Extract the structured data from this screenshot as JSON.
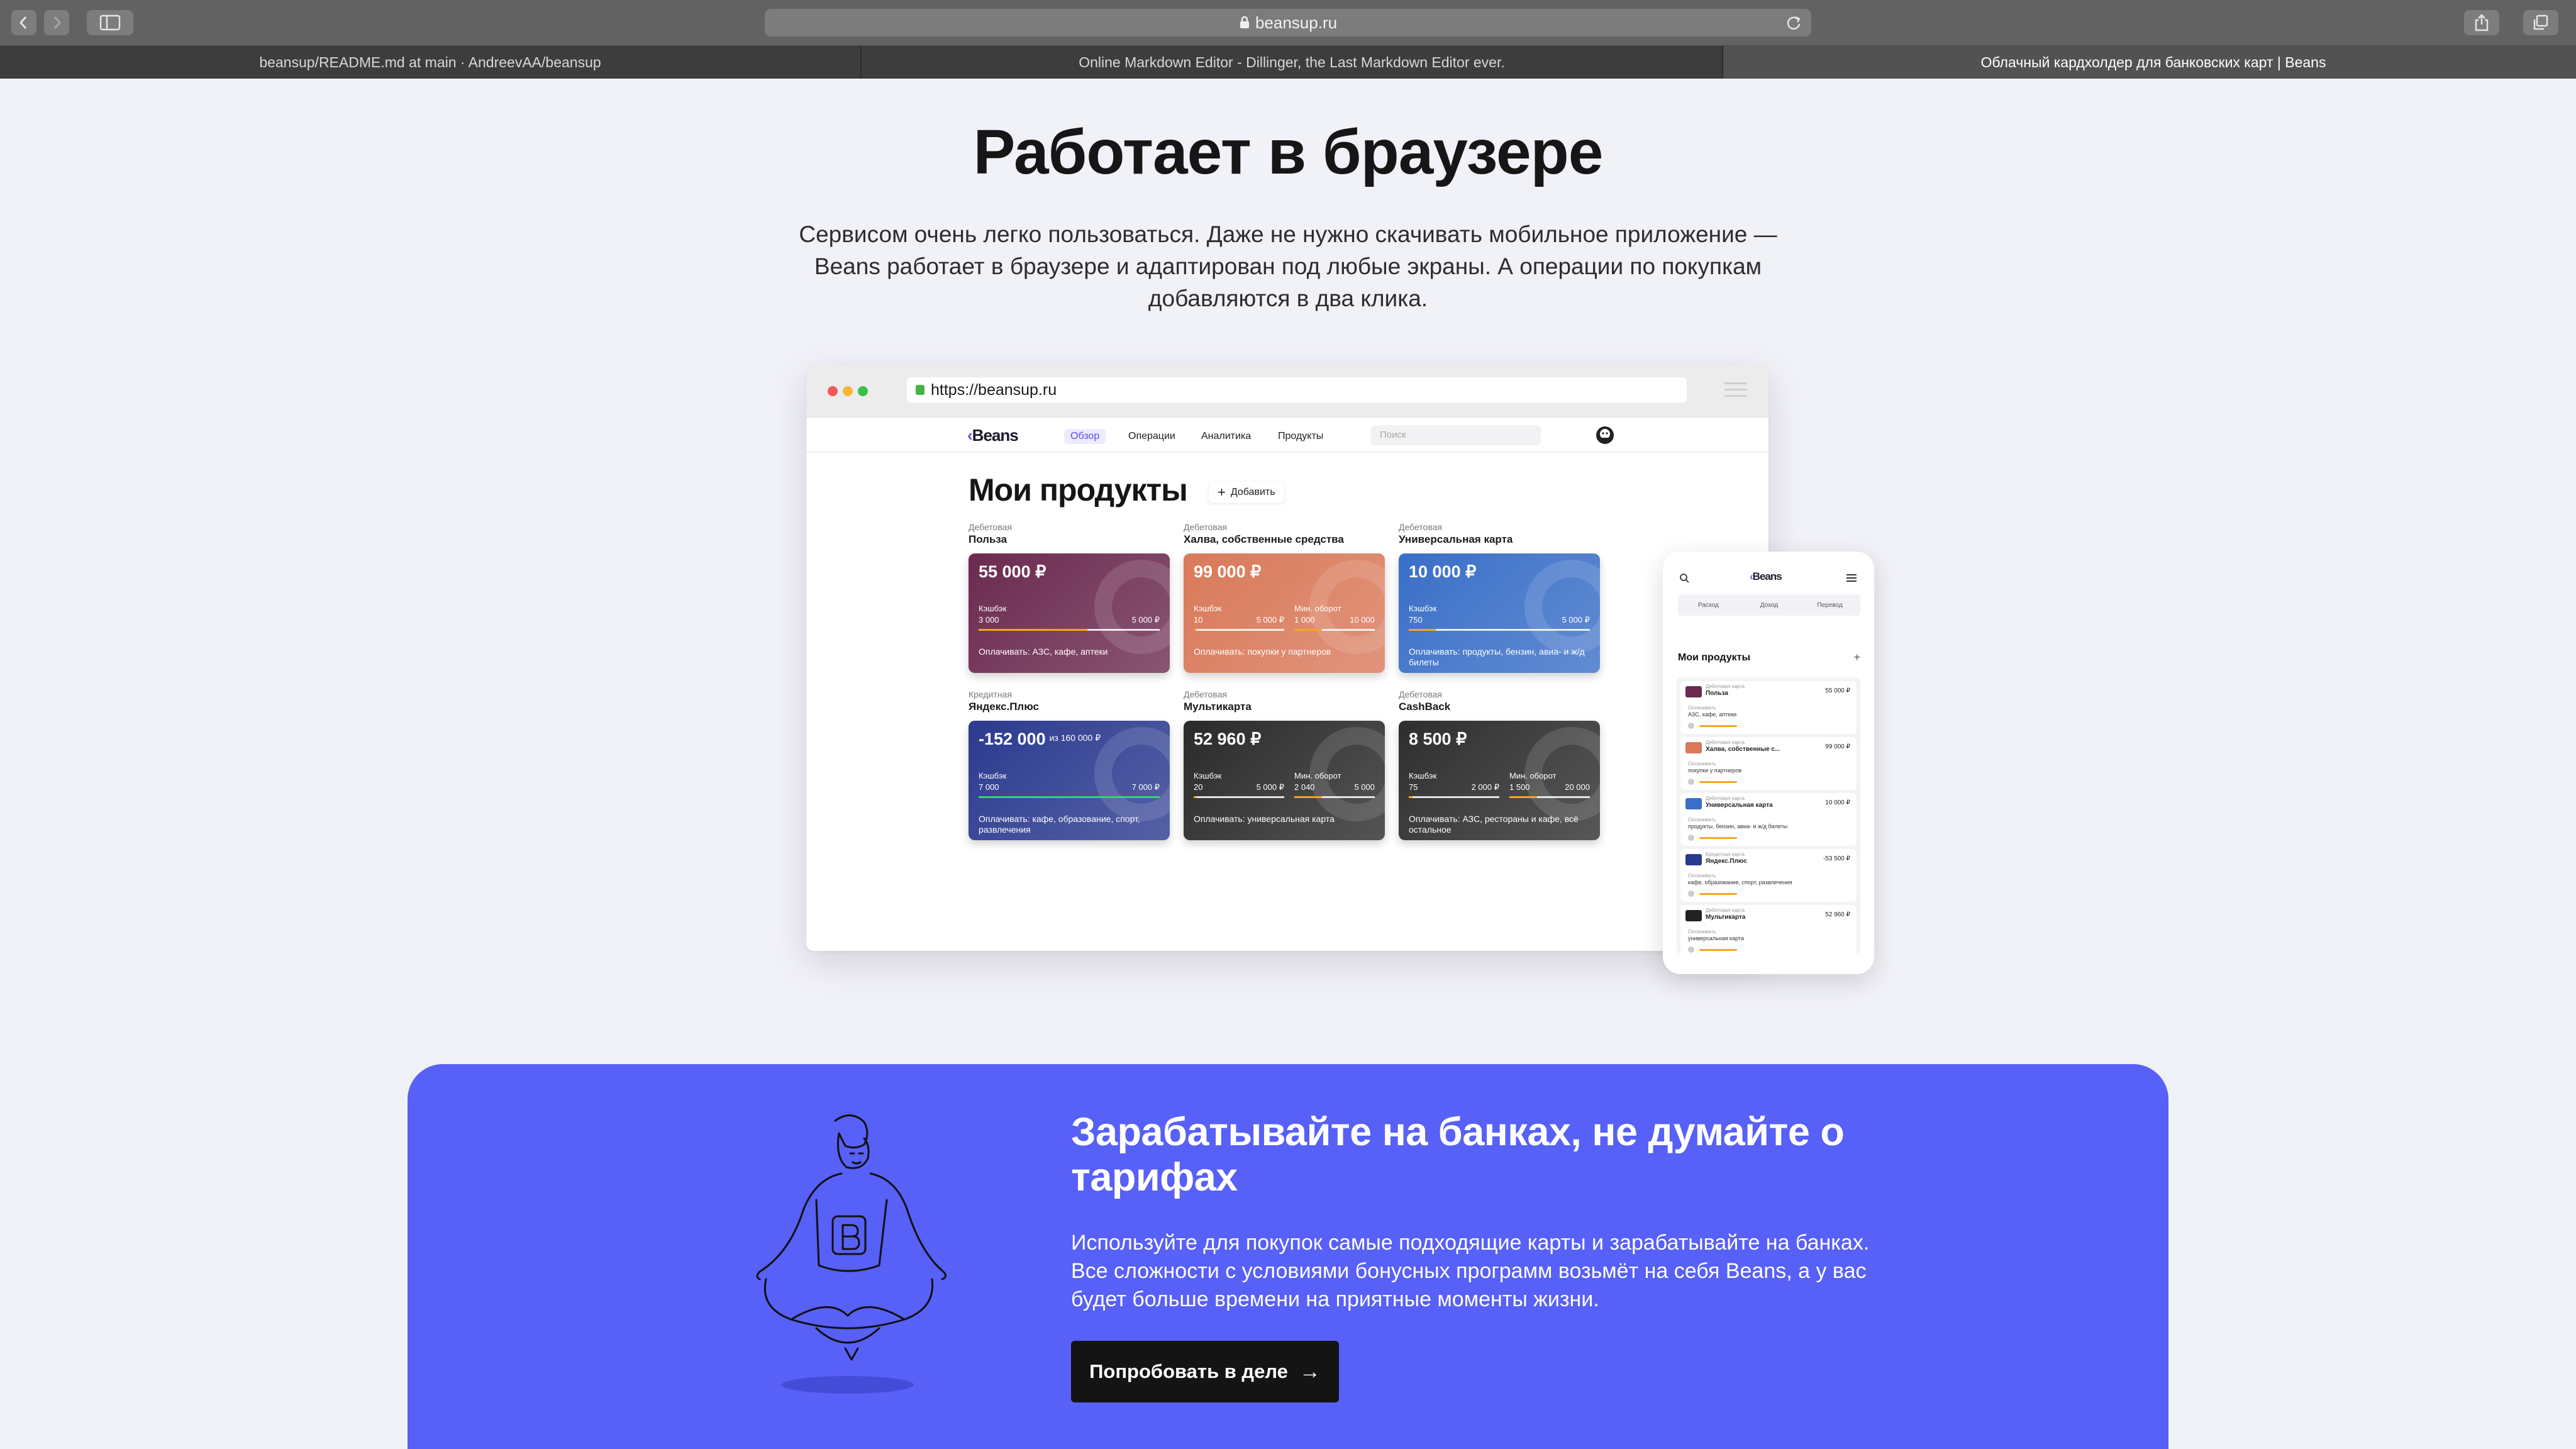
{
  "browser": {
    "url": "beansup.ru",
    "tabs": [
      {
        "title": "beansup/README.md at main · AndreevAA/beansup",
        "active": false
      },
      {
        "title": "Online Markdown Editor - Dillinger, the Last Markdown Editor ever.",
        "active": false
      },
      {
        "title": "Облачный кардхолдер для банковских карт | Beans",
        "active": true
      }
    ],
    "icons": [
      "back-icon",
      "forward-icon",
      "sidebar-icon",
      "lock-icon",
      "reload-icon",
      "share-icon",
      "tabs-icon",
      "new-tab-icon"
    ]
  },
  "hero": {
    "title": "Работает в браузере",
    "lead": "Сервисом очень легко пользоваться. Даже не нужно скачивать мобильное приложение — Beans работает в браузере и адаптирован под любые экраны. А операции по покупкам добавляются в два клика."
  },
  "desktop_mock": {
    "url": "https://beansup.ru",
    "logo": "Beans",
    "nav": [
      "Обзор",
      "Операции",
      "Аналитика",
      "Продукты"
    ],
    "search_placeholder": "Поиск",
    "heading": "Мои продукты",
    "add_label": "Добавить",
    "cards": [
      {
        "type": "Дебетовая",
        "name": "Польза",
        "amount": "55 000 ₽",
        "l1": "Кэшбэк",
        "v1a": "3 000",
        "v1b": "5 000 ₽",
        "l2": "",
        "v2a": "",
        "v2b": "",
        "pay": "Оплачивать: АЗС, кафе, аптеки",
        "color": "#6b2a4f",
        "fill": 0.6,
        "fill_color": "#f5a623"
      },
      {
        "type": "Дебетовая",
        "name": "Халва, собственные средства",
        "amount": "99 000 ₽",
        "l1": "Кэшбэк",
        "v1a": "10",
        "v1b": "5 000 ₽",
        "l2": "Мин. оборот",
        "v2a": "1 000",
        "v2b": "10 000",
        "pay": "Оплачивать: покупки у партнеров",
        "color": "#d9795a",
        "fill": 0.02,
        "fill_color": "#f5a623"
      },
      {
        "type": "Дебетовая",
        "name": "Универсальная карта",
        "amount": "10 000 ₽",
        "l1": "Кэшбэк",
        "v1a": "750",
        "v1b": "5 000 ₽",
        "l2": "",
        "v2a": "",
        "v2b": "",
        "pay": "Оплачивать: продукты, бензин, авиа- и ж/д билеты",
        "color": "#3a6fc7",
        "fill": 0.15,
        "fill_color": "#f5a623"
      },
      {
        "type": "Кредитная",
        "name": "Яндекс.Плюс",
        "amount": "-152 000",
        "amount_of": "из 160 000 ₽",
        "l1": "Кэшбэк",
        "v1a": "7 000",
        "v1b": "7 000 ₽",
        "l2": "",
        "v2a": "",
        "v2b": "",
        "pay": "Оплачивать: кафе, образование, спорт, развлечения",
        "color": "#2b3a8f",
        "fill": 1.0,
        "fill_color": "#3bd16f"
      },
      {
        "type": "Дебетовая",
        "name": "Мультикарта",
        "amount": "52 960 ₽",
        "l1": "Кэшбэк",
        "v1a": "20",
        "v1b": "5 000 ₽",
        "l2": "Мин. оборот",
        "v2a": "2 040",
        "v2b": "5 000",
        "pay": "Оплачивать: универсальная карта",
        "color": "#2a2a2a",
        "fill": 0.02,
        "fill_color": "#f5a623"
      },
      {
        "type": "Дебетовая",
        "name": "CashBack",
        "amount": "8 500 ₽",
        "l1": "Кэшбэк",
        "v1a": "75",
        "v1b": "2 000 ₽",
        "l2": "Мин. оборот",
        "v2a": "1 500",
        "v2b": "20 000",
        "pay": "Оплачивать: АЗС, рестораны и кафе, всё остальное",
        "color": "#2e2e2e",
        "fill": 0.04,
        "fill_color": "#f5a623"
      }
    ]
  },
  "phone_mock": {
    "logo": "Beans",
    "segments": [
      "Расход",
      "Доход",
      "Перевод"
    ],
    "heading": "Мои продукты",
    "items": [
      {
        "type": "Дебетовая карта",
        "name": "Польза",
        "value": "55 000 ₽",
        "pay_label": "Оплачивать",
        "pay": "АЗС, кафе, аптеки",
        "color": "#6b2a4f"
      },
      {
        "type": "Дебетовая карта",
        "name": "Халва, собственные с...",
        "value": "99 000 ₽",
        "pay_label": "Оплачивать",
        "pay": "покупки у партнеров",
        "color": "#d9795a"
      },
      {
        "type": "Дебетовая карта",
        "name": "Универсальная карта",
        "value": "10 000 ₽",
        "pay_label": "Оплачивать",
        "pay": "продукты, бензин, авиа- и ж/д билеты",
        "color": "#3a6fc7"
      },
      {
        "type": "Кредитная карта",
        "name": "Яндекс.Плюс",
        "value": "-53 500 ₽",
        "pay_label": "Оплачивать",
        "pay": "кафе, образование, спорт, развлечения",
        "color": "#2b3a8f"
      },
      {
        "type": "Дебетовая карта",
        "name": "Мультикарта",
        "value": "52 960 ₽",
        "pay_label": "Оплачивать",
        "pay": "универсальная карта",
        "color": "#222222"
      }
    ]
  },
  "promo": {
    "title": "Зарабатывайте на банках, не думайте о тарифах",
    "text": "Используйте для покупок самые подходящие карты и зарабатывайте на банках. Все сложности с условиями бонусных программ возьмёт на себя Beans, а у вас будет больше времени на приятные моменты жизни.",
    "cta": "Попробовать в деле",
    "bg": "#5760f7"
  }
}
